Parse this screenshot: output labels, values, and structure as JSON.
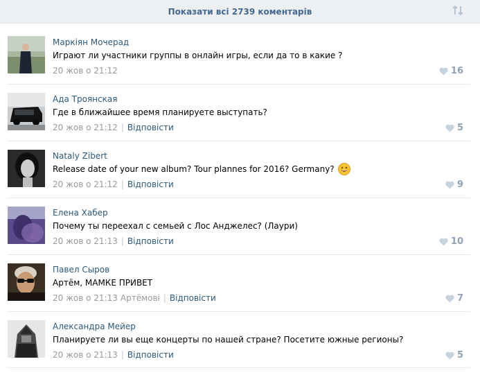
{
  "header": {
    "show_all_label": "Показати всі 2739 коментарів",
    "sort_icon": "sort-arrows-icon"
  },
  "comments": [
    {
      "author": "Маркіян Мочерад",
      "text": "Играют ли участники группы в онлайн игры, если да то в какие ?",
      "date": "20 жов о 21:12",
      "reply_to": "",
      "reply_label": "",
      "likes": "16",
      "avatar": "avatar-man-in-suit"
    },
    {
      "author": "Ада Троянская",
      "text": "Где в ближайшее время планируете выступать?",
      "date": "20 жов о 21:12",
      "reply_to": "",
      "reply_label": "Відповісти",
      "likes": "5",
      "avatar": "avatar-black-suv"
    },
    {
      "author": "Nataly Zibert",
      "text": "Release date of your new album? Tour plannes for 2016? Germany?",
      "date": "20 жов о 21:12",
      "reply_to": "",
      "reply_label": "Відповісти",
      "likes": "9",
      "avatar": "avatar-woman-portrait"
    },
    {
      "author": "Елена Хабер",
      "text": "Почему ты переехал с семьей с Лос Анджелес? (Лаури)",
      "date": "20 жов о 21:13",
      "reply_to": "",
      "reply_label": "Відповісти",
      "likes": "10",
      "avatar": "avatar-purple-blur"
    },
    {
      "author": "Павел Сыров",
      "text": "Артём, МАМКЕ ПРИВЕТ",
      "date": "20 жов о 21:13",
      "reply_to": "Артёмові",
      "reply_label": "Відповісти",
      "likes": "7",
      "avatar": "avatar-man-sunglasses"
    },
    {
      "author": "Александра Мейер",
      "text": "Планируете ли вы еще концерты по нашей стране? Посетите южные регионы?",
      "date": "20 жов о 21:13",
      "reply_to": "",
      "reply_label": "Відповісти",
      "likes": "5",
      "avatar": "avatar-hooded-figure"
    }
  ],
  "colors": {
    "link": "#2b587a",
    "header_bg": "#edf0f3",
    "meta": "#999999",
    "like": "#8fa1b4"
  }
}
